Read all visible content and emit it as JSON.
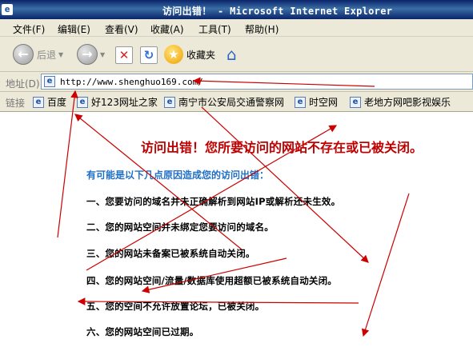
{
  "window": {
    "title": "访问出错！ - Microsoft Internet Explorer"
  },
  "menu": [
    "文件(F)",
    "编辑(E)",
    "查看(V)",
    "收藏(A)",
    "工具(T)",
    "帮助(H)"
  ],
  "toolbar": {
    "back_label": "后退",
    "favorites_label": "收藏夹"
  },
  "address": {
    "label": "地址(D)",
    "url": "http://www.shenghuo169.com/"
  },
  "links": {
    "label": "链接",
    "items": [
      "百度",
      "好123网址之家",
      "南宁市公安局交通警察网",
      "时空网",
      "老地方网吧影视娱乐"
    ]
  },
  "page": {
    "heading": "访问出错！您所要访问的网站不存在或已被关闭。",
    "subheading": "有可能是以下几点原因造成您的访问出错：",
    "reasons": [
      "一、您要访问的域名并未正确解析到网站IP或解析还未生效。",
      "二、您的网站空间并未绑定您要访问的域名。",
      "三、您的网站未备案已被系统自动关闭。",
      "四、您的网站空间/流量/数据库使用超额已被系统自动关闭。",
      "五、您的空间不允许放置论坛，已被关闭。",
      "六、您的网站空间已过期。"
    ]
  },
  "annotation": {
    "arrow_color": "#cc0000"
  }
}
